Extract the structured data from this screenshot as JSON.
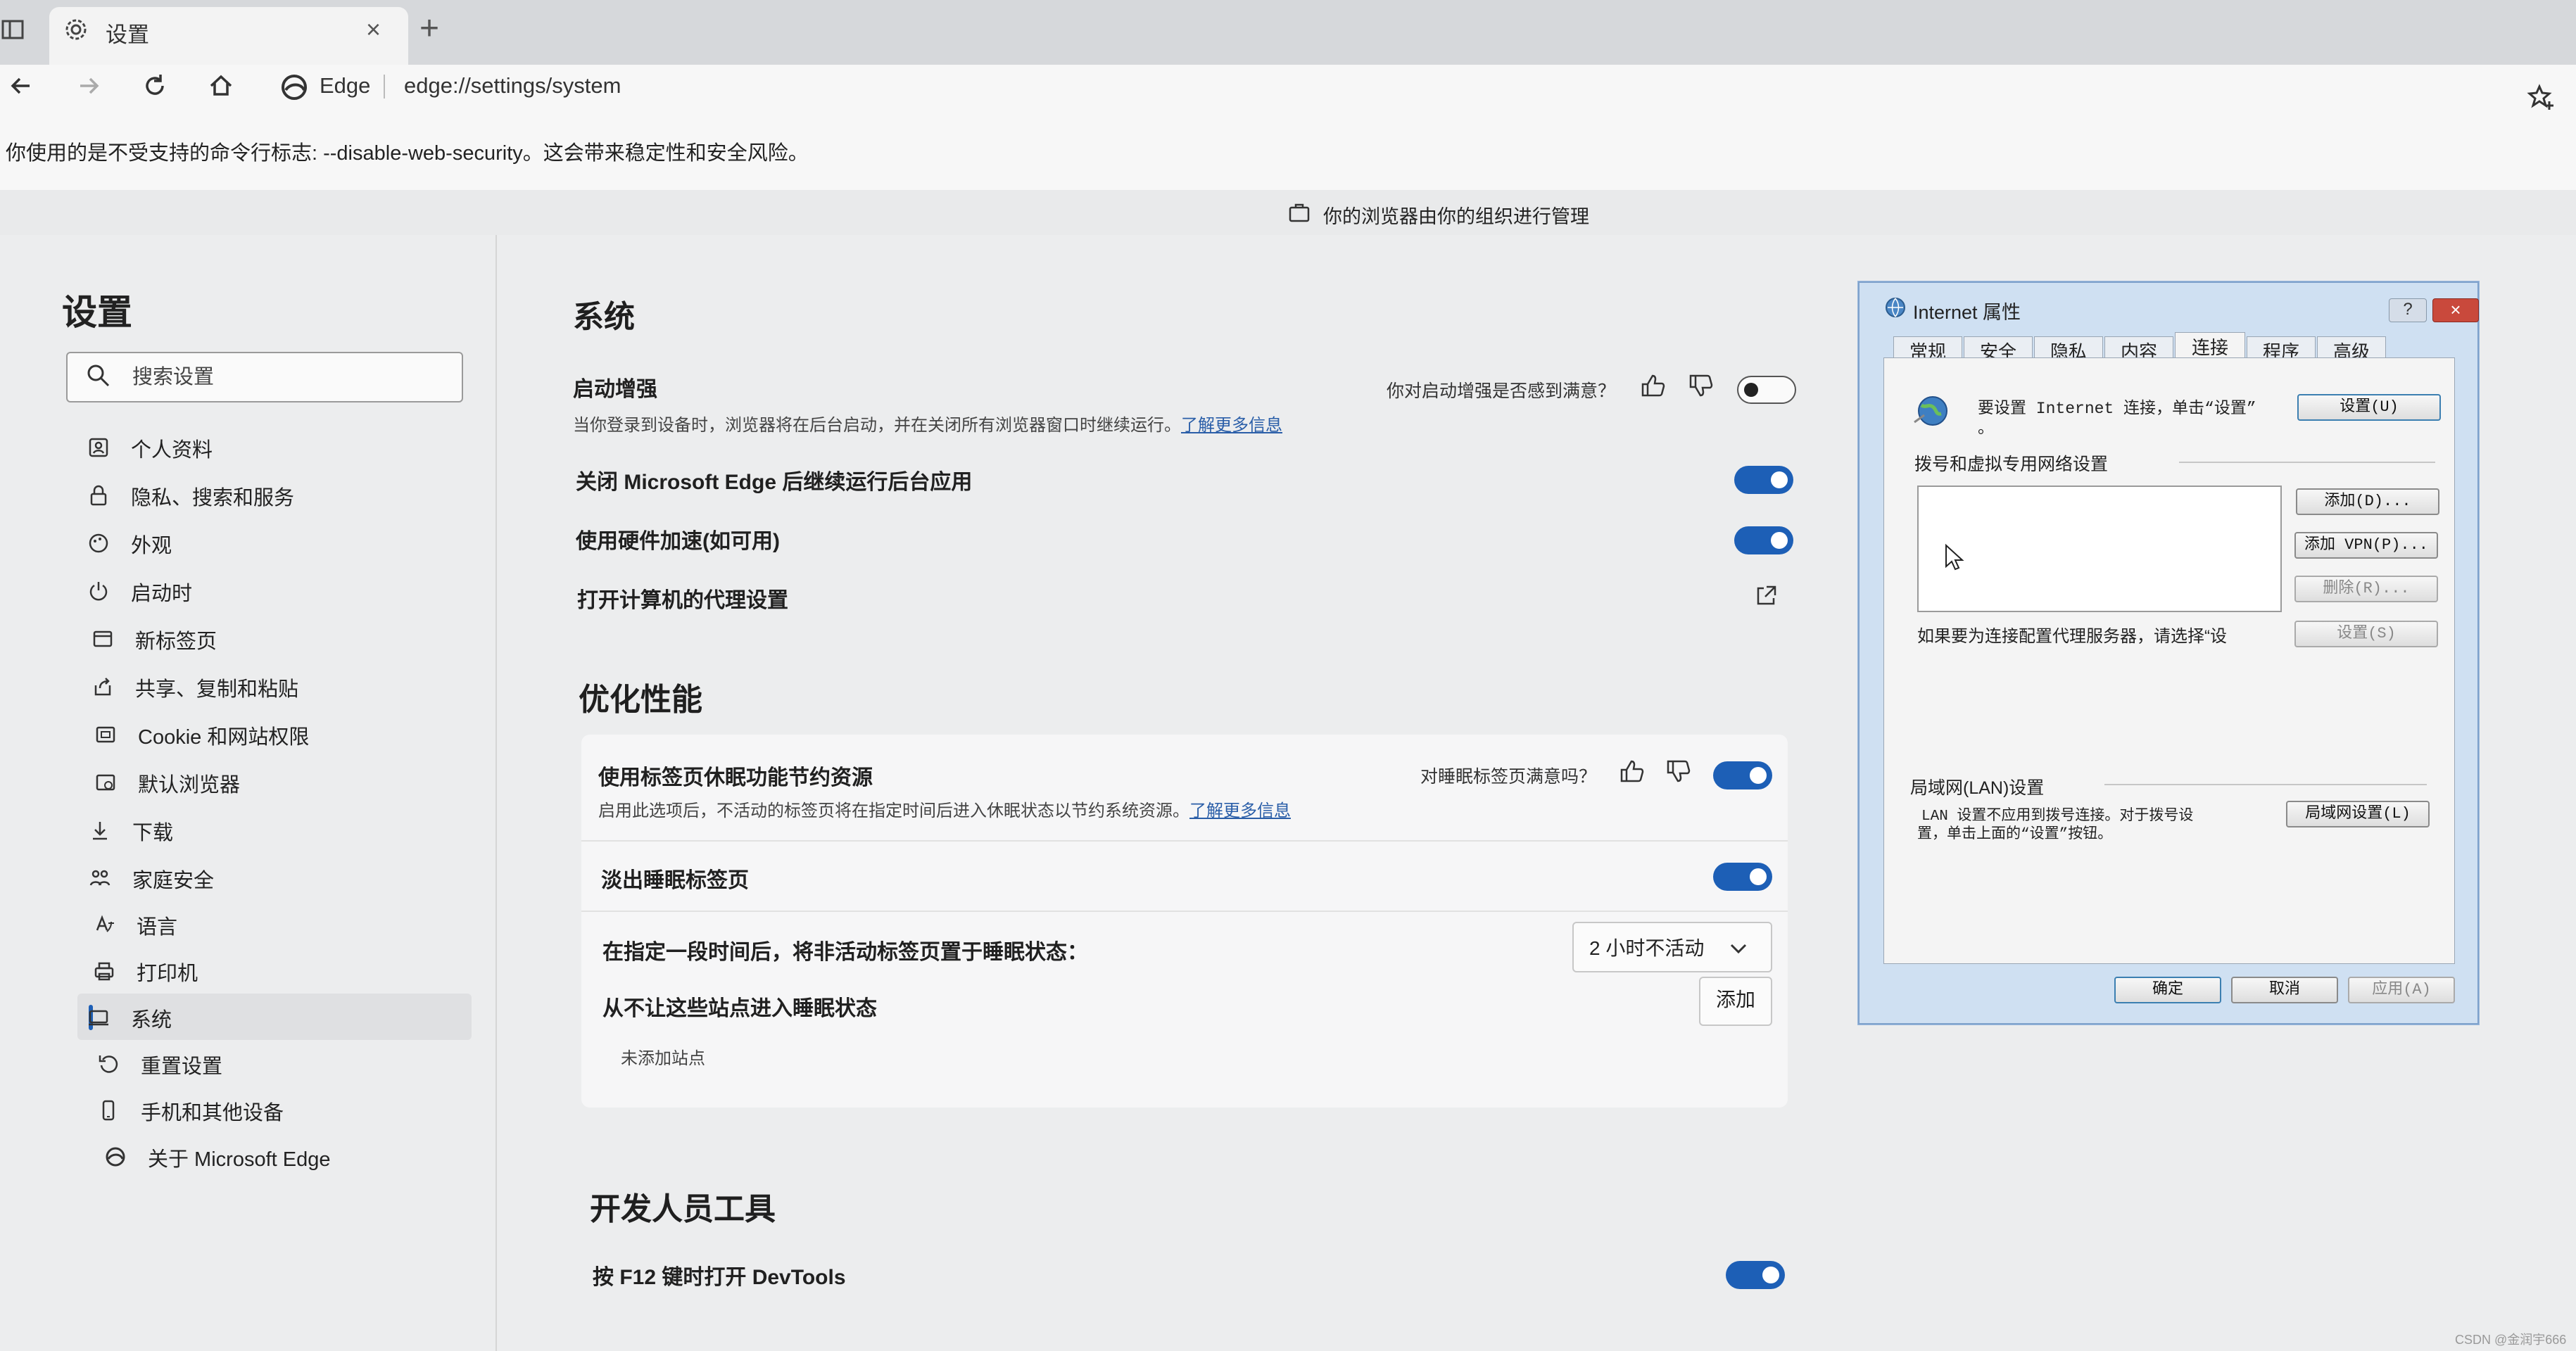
{
  "browser": {
    "tab_title": "设置",
    "tab_close": "×",
    "new_tab": "+",
    "address_site_label": "Edge",
    "address_url": "edge://settings/system"
  },
  "banners": {
    "warning": "你使用的是不受支持的命令行标志: --disable-web-security。这会带来稳定性和安全风险。",
    "managed": "你的浏览器由你的组织进行管理"
  },
  "sidebar": {
    "title": "设置",
    "search_placeholder": "搜索设置",
    "items": [
      {
        "label": "个人资料",
        "icon": "profile-icon"
      },
      {
        "label": "隐私、搜索和服务",
        "icon": "lock-icon"
      },
      {
        "label": "外观",
        "icon": "appearance-icon"
      },
      {
        "label": "启动时",
        "icon": "power-icon"
      },
      {
        "label": "新标签页",
        "icon": "new-tab-icon"
      },
      {
        "label": "共享、复制和粘贴",
        "icon": "share-icon"
      },
      {
        "label": "Cookie 和网站权限",
        "icon": "site-permissions-icon"
      },
      {
        "label": "默认浏览器",
        "icon": "default-browser-icon"
      },
      {
        "label": "下载",
        "icon": "download-icon"
      },
      {
        "label": "家庭安全",
        "icon": "family-icon"
      },
      {
        "label": "语言",
        "icon": "language-icon"
      },
      {
        "label": "打印机",
        "icon": "printer-icon"
      },
      {
        "label": "系统",
        "icon": "system-icon",
        "active": true
      },
      {
        "label": "重置设置",
        "icon": "reset-icon"
      },
      {
        "label": "手机和其他设备",
        "icon": "phone-icon"
      },
      {
        "label": "关于 Microsoft Edge",
        "icon": "edge-icon"
      }
    ]
  },
  "system": {
    "heading": "系统",
    "startup_boost": {
      "title": "启动增强",
      "desc": "当你登录到设备时，浏览器将在后台启动，并在关闭所有浏览器窗口时继续运行。",
      "link": "了解更多信息",
      "feedback": "你对启动增强是否感到满意？",
      "enabled": false
    },
    "background_apps": {
      "title": "关闭 Microsoft Edge 后继续运行后台应用",
      "enabled": true
    },
    "hardware_accel": {
      "title": "使用硬件加速(如可用)",
      "enabled": true
    },
    "proxy": {
      "title": "打开计算机的代理设置"
    }
  },
  "performance": {
    "heading": "优化性能",
    "sleeping_tabs": {
      "title": "使用标签页休眠功能节约资源",
      "desc": "启用此选项后，不活动的标签页将在指定时间后进入休眠状态以节约系统资源。",
      "link": "了解更多信息",
      "feedback": "对睡眠标签页满意吗？",
      "enabled": true
    },
    "fade_tabs": {
      "title": "淡出睡眠标签页",
      "enabled": true
    },
    "sleep_after": {
      "title": "在指定一段时间后，将非活动标签页置于睡眠状态：",
      "value": "2 小时不活动"
    },
    "never_sleep": {
      "title": "从不让这些站点进入睡眠状态",
      "add_label": "添加",
      "empty": "未添加站点"
    }
  },
  "devtools": {
    "heading": "开发人员工具",
    "f12": {
      "title": "按 F12 键时打开 DevTools",
      "enabled": true
    }
  },
  "internet_properties": {
    "title": "Internet 属性",
    "help": "?",
    "close": "×",
    "tabs": [
      "常规",
      "安全",
      "隐私",
      "内容",
      "连接",
      "程序",
      "高级"
    ],
    "selected_tab": "连接",
    "setup_text": "要设置 Internet 连接，单击“设置”",
    "setup_text_2": "。",
    "setup_btn": "设置(U)",
    "vpn_group": "拨号和虚拟专用网络设置",
    "add_btn": "添加(D)...",
    "add_vpn_btn": "添加 VPN(P)...",
    "remove_btn": "删除(R)...",
    "settings_btn": "设置(S)",
    "proxy_note": "如果要为连接配置代理服务器，请选择“设",
    "lan_group": "局域网(LAN)设置",
    "lan_note_1": "LAN 设置不应用到拨号连接。对于拨号设",
    "lan_note_2": "置，单击上面的“设置”按钮。",
    "lan_btn": "局域网设置(L)",
    "ok": "确定",
    "cancel": "取消",
    "apply": "应用(A)"
  },
  "watermark": "CSDN @金润宇666",
  "colors": {
    "accent": "#1d5fb6",
    "link": "#2a5ea8",
    "dialog_frame": "#cfe0f2"
  }
}
